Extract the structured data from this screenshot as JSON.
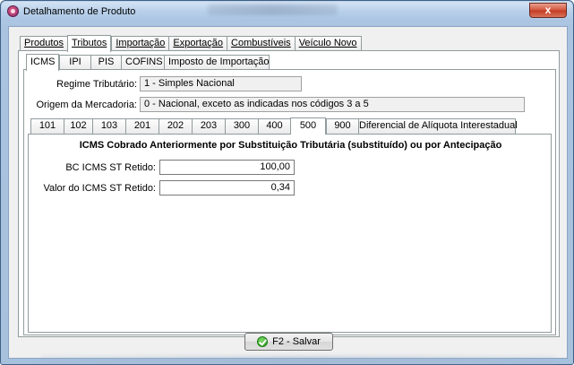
{
  "window": {
    "title": "Detalhamento de Produto",
    "close_label": "x"
  },
  "main_tabs": [
    {
      "label": "Produtos",
      "active": false
    },
    {
      "label": "Tributos",
      "active": true
    },
    {
      "label": "Importação",
      "active": false
    },
    {
      "label": "Exportação",
      "active": false
    },
    {
      "label": "Combustíveis",
      "active": false
    },
    {
      "label": "Veículo Novo",
      "active": false
    }
  ],
  "tax_tabs": [
    {
      "label": "ICMS",
      "active": true
    },
    {
      "label": "IPI",
      "active": false
    },
    {
      "label": "PIS",
      "active": false
    },
    {
      "label": "COFINS",
      "active": false
    },
    {
      "label": "Imposto de Importação",
      "active": false
    }
  ],
  "icms": {
    "regime_label": "Regime Tributário:",
    "regime_value": "1 - Simples Nacional",
    "origem_label": "Origem da Mercadoria:",
    "origem_value": "0 - Nacional, exceto as indicadas nos códigos 3 a 5"
  },
  "cst_tabs": [
    {
      "label": "101",
      "active": false
    },
    {
      "label": "102",
      "active": false
    },
    {
      "label": "103",
      "active": false
    },
    {
      "label": "201",
      "active": false
    },
    {
      "label": "202",
      "active": false
    },
    {
      "label": "203",
      "active": false
    },
    {
      "label": "300",
      "active": false
    },
    {
      "label": "400",
      "active": false
    },
    {
      "label": "500",
      "active": true
    },
    {
      "label": "900",
      "active": false
    },
    {
      "label": "Diferencial de Alíquota Interestadual",
      "active": false
    }
  ],
  "st_section": {
    "title": "ICMS Cobrado Anteriormente por Substituição Tributária (substituído) ou por Antecipação",
    "bc_label": "BC ICMS ST Retido:",
    "bc_value": "100,00",
    "valor_label": "Valor do ICMS ST Retido:",
    "valor_value": "0,34"
  },
  "footer": {
    "save_label": "F2 - Salvar"
  },
  "colors": {
    "accent_check": "#2b9a1e",
    "close_red": "#c23a23"
  }
}
